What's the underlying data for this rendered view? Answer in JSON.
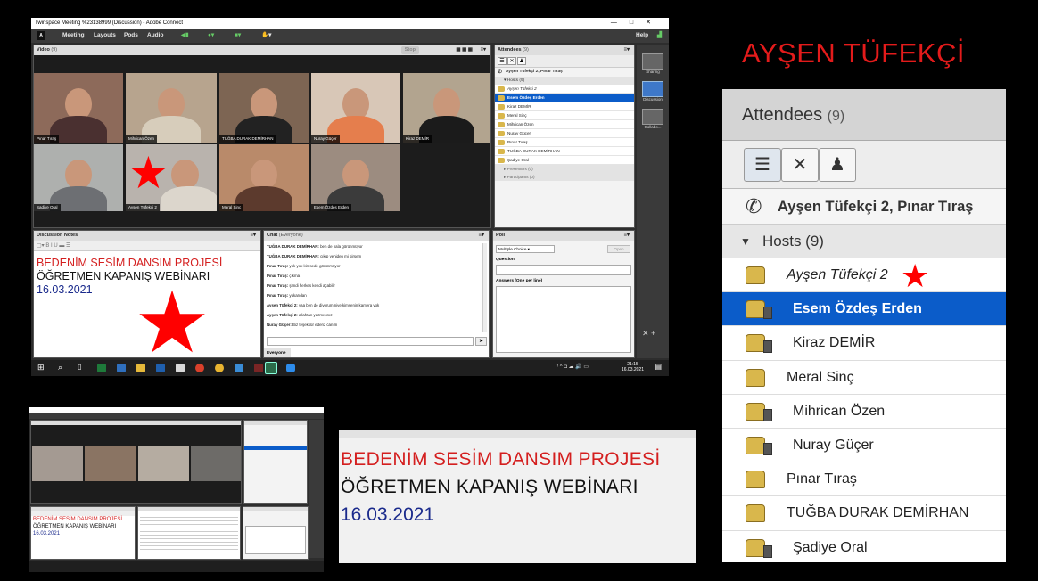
{
  "overlay_title": "AYŞEN TÜFEKÇİ",
  "window": {
    "title": "Twinspace Meeting %23138999 (Discussion) - Adobe Connect",
    "menu": [
      "Meeting",
      "Layouts",
      "Pods",
      "Audio"
    ],
    "help": "Help",
    "logo": "Adobe"
  },
  "video_pod": {
    "title": "Video",
    "count": "(9)",
    "stop_label": "Stop",
    "tiles": [
      "Pınar Tıraş",
      "Mihrican Özen",
      "TUĞBA DURAK DEMİRHAN",
      "Nuray Güçer",
      "Kiraz DEMİR",
      "Şadiye Oral",
      "Ayşen Tüfekçi 2",
      "Meral Sinç",
      "Esem Özdeş Erden"
    ]
  },
  "attendees_small": {
    "title": "Attendees",
    "count": "(9)",
    "conference": "Ayşen Tüfekçi 2, Pınar Tıraş",
    "hosts_label": "Hosts (9)",
    "hosts": [
      "Ayşen Tüfekçi 2",
      "Esem Özdeş Erden",
      "Kiraz DEMİR",
      "Meral Sinç",
      "Mihrican Özen",
      "Nuray Güçer",
      "Pınar Tıraş",
      "TUĞBA DURAK DEMİRHAN",
      "Şadiye Oral"
    ],
    "presenters": "Presenters (0)",
    "participants": "Participants (0)"
  },
  "layouts": [
    "Sharing",
    "Discussion",
    "Collabo..."
  ],
  "notes": {
    "title": "Discussion Notes",
    "line1": "BEDENİM SESİM DANSIM PROJESİ",
    "line2": "ÖĞRETMEN KAPANIŞ WEBİNARI",
    "line3": "16.03.2021"
  },
  "chat": {
    "title": "Chat",
    "scope": "(Everyone)",
    "messages": [
      {
        "who": "TUĞBA DURAK DEMİRHAN:",
        "text": " ben de hala görünmüyor"
      },
      {
        "who": "TUĞBA DURAK DEMİRHAN:",
        "text": " çıkıp yeniden mi girsem"
      },
      {
        "who": "Pınar Tıraş:",
        "text": " yok yok kimsede görünmüyor"
      },
      {
        "who": "Pınar Tıraş:",
        "text": " çıkma"
      },
      {
        "who": "Pınar Tıraş:",
        "text": " şimdi herkes kendi açabilir"
      },
      {
        "who": "Pınar Tıraş:",
        "text": " yukarıdan"
      },
      {
        "who": "Ayşen Tüfekçi 2:",
        "text": " yaa ben de diyorum niye kimsenin kamera yok"
      },
      {
        "who": "Ayşen Tüfekçi 2:",
        "text": " allahtan yazmışınız"
      },
      {
        "who": "Nuray Güçer:",
        "text": " Biz teşekkür ederiz canım"
      }
    ],
    "tab": "Everyone"
  },
  "poll": {
    "title": "Poll",
    "type": "Multiple Choice",
    "open": "Open",
    "question": "Question",
    "answers": "Answers (One per line)"
  },
  "taskbar": {
    "time": "21:15",
    "date": "16.03.2021"
  },
  "big_attendees": {
    "title": "Attendees",
    "count": "(9)",
    "conference": "Ayşen Tüfekçi 2, Pınar Tıraş",
    "hosts_label": "Hosts (9)",
    "hosts": [
      "Ayşen Tüfekçi 2",
      "Esem Özdeş Erden",
      "Kiraz DEMİR",
      "Meral Sinç",
      "Mihrican Özen",
      "Nuray Güçer",
      "Pınar Tıraş",
      "TUĞBA DURAK DEMİRHAN",
      "Şadiye Oral"
    ]
  },
  "zoom_notes": {
    "line1": "BEDENİM SESİM DANSIM PROJESİ",
    "line2": "ÖĞRETMEN KAPANIŞ WEBİNARI",
    "line3": "16.03.2021"
  },
  "colors": {
    "accent_red": "#e31b1b",
    "selection_blue": "#0b5cc9",
    "date_blue": "#1a2a8c"
  }
}
